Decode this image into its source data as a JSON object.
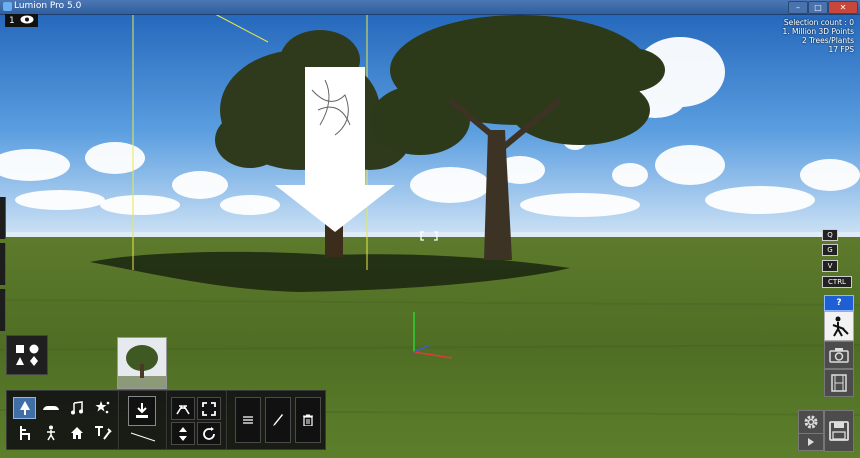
{
  "window": {
    "title": "Lumion Pro 5.0"
  },
  "layer": {
    "number": "1"
  },
  "stats": {
    "selection": "Selection count : 0",
    "line1": "1. Million 3D Points",
    "line2": "2 Trees/Plants",
    "fps": "17 FPS"
  },
  "keyhints": [
    "Q",
    "G",
    "V"
  ],
  "ctrl_label": "CTRL",
  "help_label": "?",
  "icons": {
    "objects": "objects-shapes-icon",
    "nature": "tree-icon",
    "transport": "car-icon",
    "sound": "music-note-icon",
    "effects": "sparkle-icon",
    "indoor": "chair-icon",
    "people": "person-icon",
    "outdoor": "house-icon",
    "utilities": "text-tools-icon",
    "place": "place-object-icon",
    "move": "move-arrows-icon",
    "scale": "scale-corners-icon",
    "height": "height-arrows-icon",
    "rotate": "rotate-icon",
    "properties": "menu-lines-icon",
    "edit": "pencil-icon",
    "delete": "trash-icon",
    "build": "build-mode-icon",
    "photo": "camera-icon",
    "movie": "film-icon",
    "settings": "gear-icon",
    "save": "floppy-disk-icon",
    "play": "play-icon"
  },
  "colors": {
    "accent": "#3f6fa6",
    "help": "#1f5fd6",
    "panel": "#141414"
  }
}
